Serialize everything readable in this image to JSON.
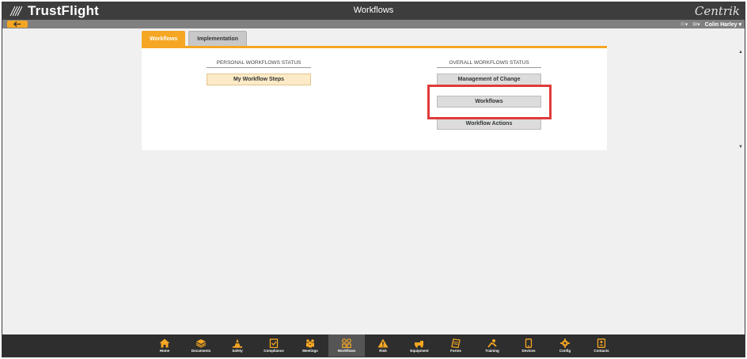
{
  "app": {
    "logo_text": "TrustFlight",
    "page_title": "Workflows",
    "brand_right": "Centrik",
    "user_name": "Colin Harley",
    "accent_color": "#f5a623",
    "highlight_color": "#e03a3a"
  },
  "tabs": [
    {
      "label": "Workflows",
      "active": true
    },
    {
      "label": "Implementation",
      "active": false
    }
  ],
  "personal": {
    "heading": "PERSONAL WORKFLOWS STATUS",
    "buttons": [
      "My Workflow Steps"
    ]
  },
  "overall": {
    "heading": "OVERALL WORKFLOWS STATUS",
    "buttons": [
      "Management of Change",
      "Workflows",
      "Workflow Actions"
    ]
  },
  "dock": [
    {
      "label": "Home",
      "icon": "home-icon"
    },
    {
      "label": "Documents",
      "icon": "documents-icon"
    },
    {
      "label": "Safety",
      "icon": "safety-cone-icon"
    },
    {
      "label": "Compliance",
      "icon": "compliance-icon"
    },
    {
      "label": "Meetings",
      "icon": "meetings-icon"
    },
    {
      "label": "Workflows",
      "icon": "workflows-icon",
      "active": true
    },
    {
      "label": "Risk",
      "icon": "risk-warning-icon"
    },
    {
      "label": "Equipment",
      "icon": "equipment-icon"
    },
    {
      "label": "Forms",
      "icon": "forms-icon"
    },
    {
      "label": "Training",
      "icon": "training-icon"
    },
    {
      "label": "Devices",
      "icon": "devices-icon"
    },
    {
      "label": "Config",
      "icon": "config-gear-icon"
    },
    {
      "label": "Contacts",
      "icon": "contacts-icon"
    }
  ]
}
